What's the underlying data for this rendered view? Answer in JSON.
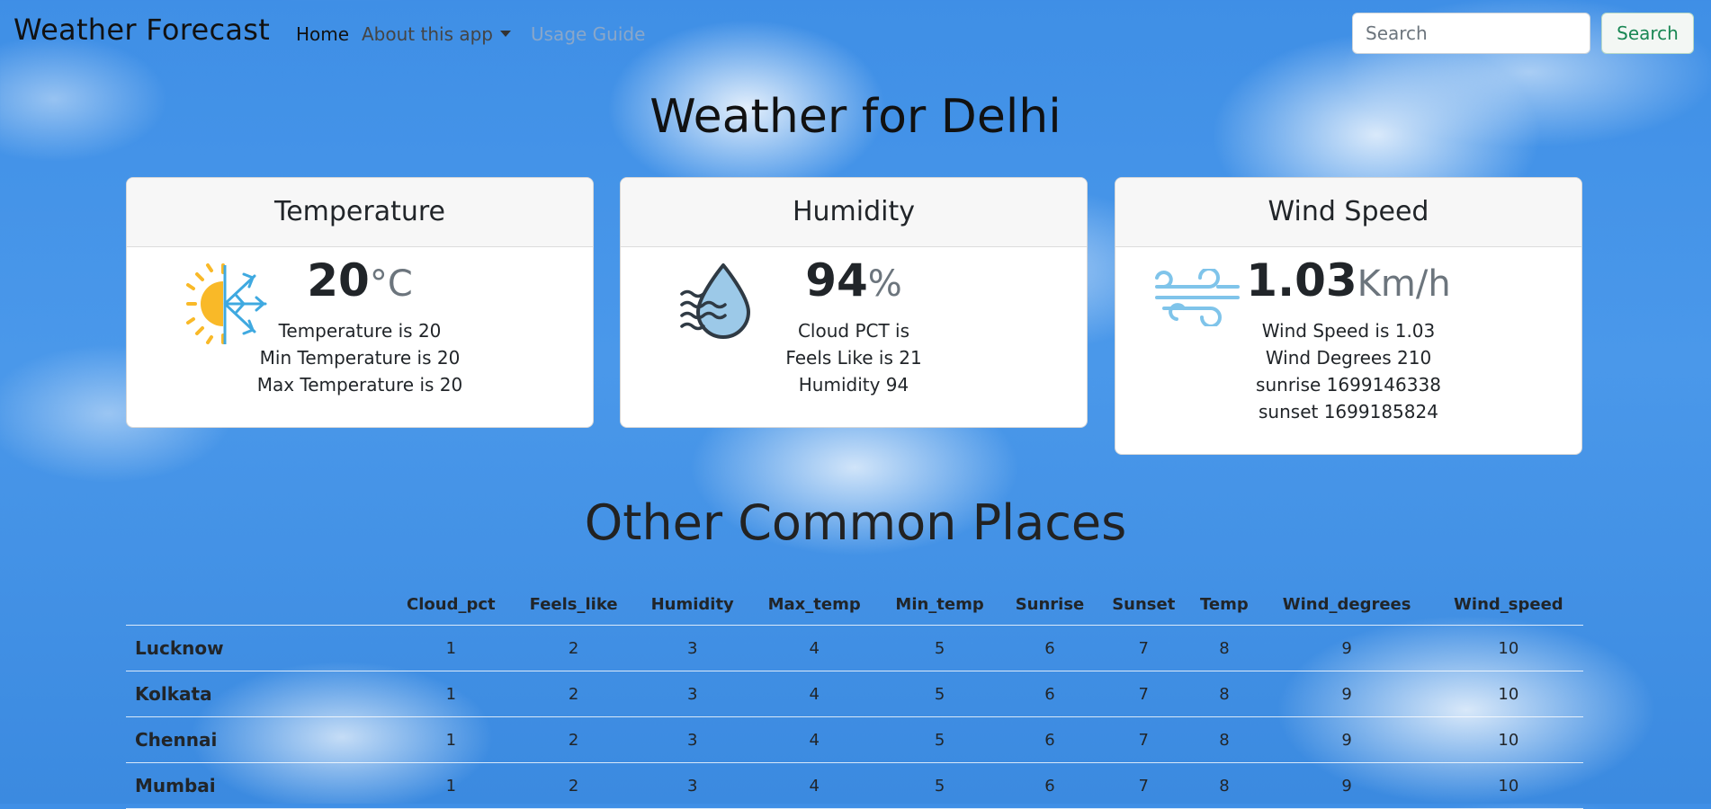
{
  "nav": {
    "brand": "Weather Forecast",
    "home": "Home",
    "about": "About this app",
    "guide": "Usage Guide",
    "search_placeholder": "Search",
    "search_button": "Search"
  },
  "page_title": "Weather for Delhi",
  "cards": {
    "temperature": {
      "title": "Temperature",
      "value": "20",
      "unit": "°C",
      "lines": [
        "Temperature is 20",
        "Min Temperature is 20",
        "Max Temperature is 20"
      ]
    },
    "humidity": {
      "title": "Humidity",
      "value": "94",
      "unit": "%",
      "lines": [
        "Cloud PCT is",
        "Feels Like is 21",
        "Humidity 94"
      ]
    },
    "wind": {
      "title": "Wind Speed",
      "value": "1.03",
      "unit": "Km/h",
      "lines": [
        "Wind Speed is 1.03",
        "Wind Degrees 210",
        "sunrise 1699146338",
        "sunset 1699185824"
      ]
    }
  },
  "section_title": "Other Common Places",
  "table": {
    "headers": [
      "",
      "Cloud_pct",
      "Feels_like",
      "Humidity",
      "Max_temp",
      "Min_temp",
      "Sunrise",
      "Sunset",
      "Temp",
      "Wind_degrees",
      "Wind_speed"
    ],
    "rows": [
      {
        "city": "Lucknow",
        "values": [
          "1",
          "2",
          "3",
          "4",
          "5",
          "6",
          "7",
          "8",
          "9",
          "10"
        ]
      },
      {
        "city": "Kolkata",
        "values": [
          "1",
          "2",
          "3",
          "4",
          "5",
          "6",
          "7",
          "8",
          "9",
          "10"
        ]
      },
      {
        "city": "Chennai",
        "values": [
          "1",
          "2",
          "3",
          "4",
          "5",
          "6",
          "7",
          "8",
          "9",
          "10"
        ]
      },
      {
        "city": "Mumbai",
        "values": [
          "1",
          "2",
          "3",
          "4",
          "5",
          "6",
          "7",
          "8",
          "9",
          "10"
        ]
      }
    ]
  },
  "icons": {
    "temperature": "sun-snowflake-icon",
    "humidity": "water-drop-icon",
    "wind": "wind-icon"
  },
  "colors": {
    "sky": "#4a98ea",
    "search_button_text": "#198754",
    "sun": "#f9b928",
    "snow": "#3fa9e0",
    "wind_icon": "#7fc4ea",
    "drop_fill": "#9cc9e8"
  }
}
